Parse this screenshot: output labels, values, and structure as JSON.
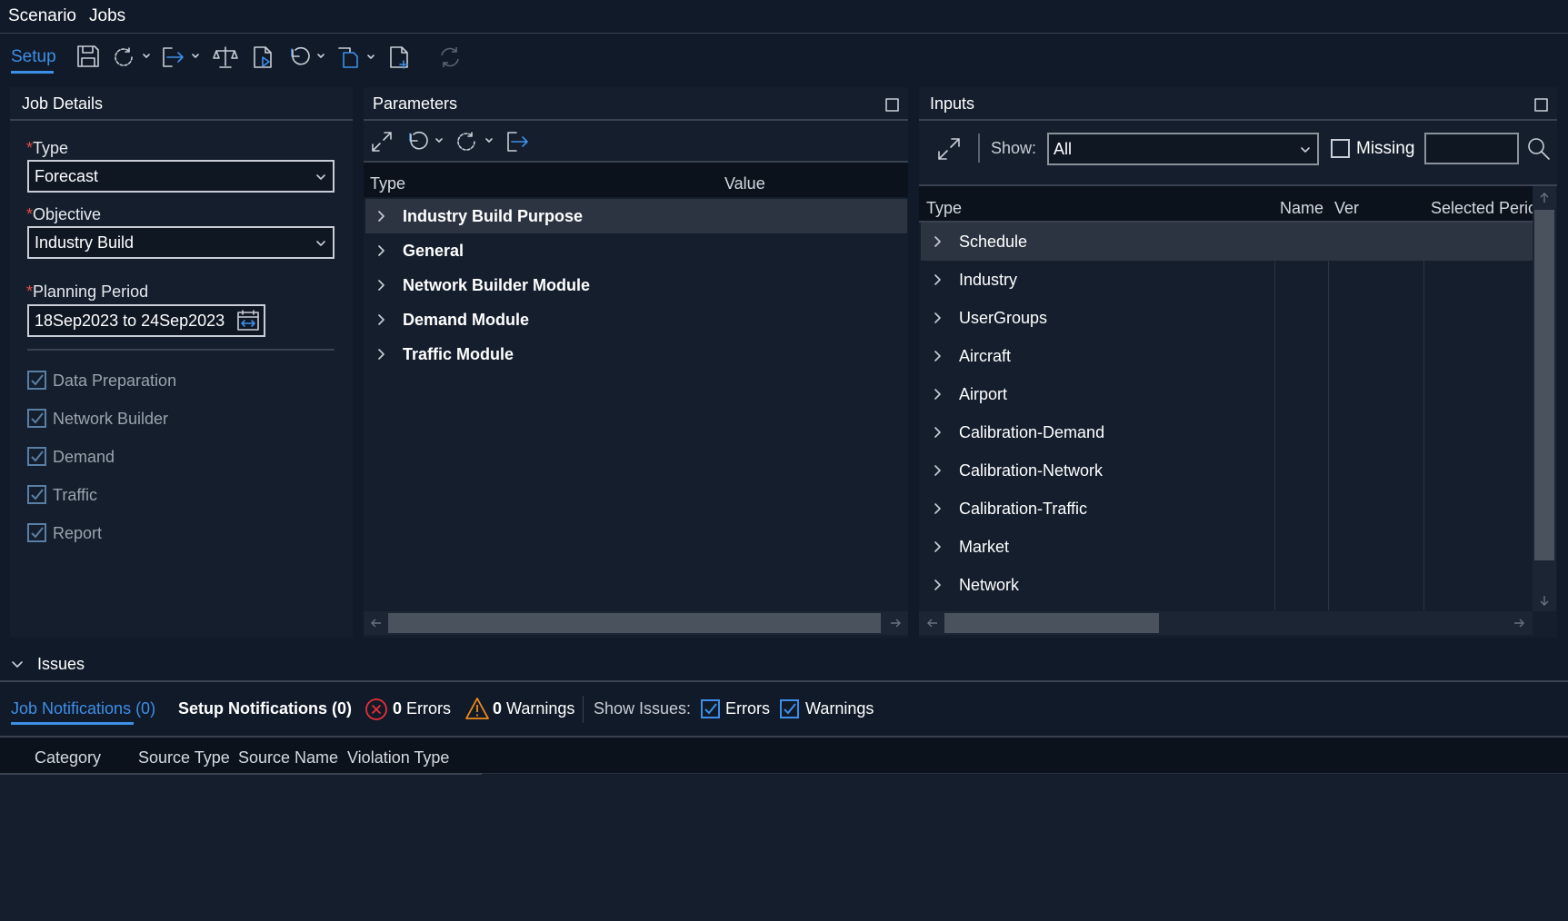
{
  "menu": {
    "scenario": "Scenario",
    "jobs": "Jobs"
  },
  "toolbar": {
    "setup_tab": "Setup",
    "icons": [
      "save-icon",
      "refresh-dropdown-icon",
      "export-dropdown-icon",
      "compare-icon",
      "run-job-icon",
      "undo-dropdown-icon",
      "copy-dropdown-icon",
      "new-document-icon",
      "sync-icon"
    ]
  },
  "job_details": {
    "title": "Job Details",
    "type_label": "Type",
    "type_value": "Forecast",
    "objective_label": "Objective",
    "objective_value": "Industry Build",
    "period_label": "Planning Period",
    "period_value": "18Sep2023 to 24Sep2023",
    "required_mark": "*",
    "steps": [
      {
        "label": "Data Preparation",
        "checked": true
      },
      {
        "label": "Network Builder",
        "checked": true
      },
      {
        "label": "Demand",
        "checked": true
      },
      {
        "label": "Traffic",
        "checked": true
      },
      {
        "label": "Report",
        "checked": true
      }
    ]
  },
  "parameters": {
    "title": "Parameters",
    "col_type": "Type",
    "col_value": "Value",
    "rows": [
      "Industry Build Purpose",
      "General",
      "Network Builder Module",
      "Demand Module",
      "Traffic Module"
    ]
  },
  "inputs": {
    "title": "Inputs",
    "show_label": "Show:",
    "show_value": "All",
    "missing_label": "Missing",
    "search_value": "",
    "col_type": "Type",
    "col_name": "Name",
    "col_ver": "Ver",
    "col_period": "Selected Perio",
    "rows": [
      "Schedule",
      "Industry",
      "UserGroups",
      "Aircraft",
      "Airport",
      "Calibration-Demand",
      "Calibration-Network",
      "Calibration-Traffic",
      "Market",
      "Network"
    ]
  },
  "issues": {
    "title": "Issues",
    "job_notifications_tab": "Job Notifications (0)",
    "setup_notifications_tab": "Setup Notifications (0)",
    "errors_count": "0",
    "errors_label": "Errors",
    "warnings_count": "0",
    "warnings_label": "Warnings",
    "show_issues_label": "Show Issues:",
    "show_errors_label": "Errors",
    "show_warnings_label": "Warnings",
    "columns": [
      "Category",
      "Source Type",
      "Source Name",
      "Violation Type"
    ]
  },
  "colors": {
    "accent": "#3d8fe8",
    "required": "#e84b4b",
    "error": "#e8303a",
    "warning": "#f08a1c"
  }
}
